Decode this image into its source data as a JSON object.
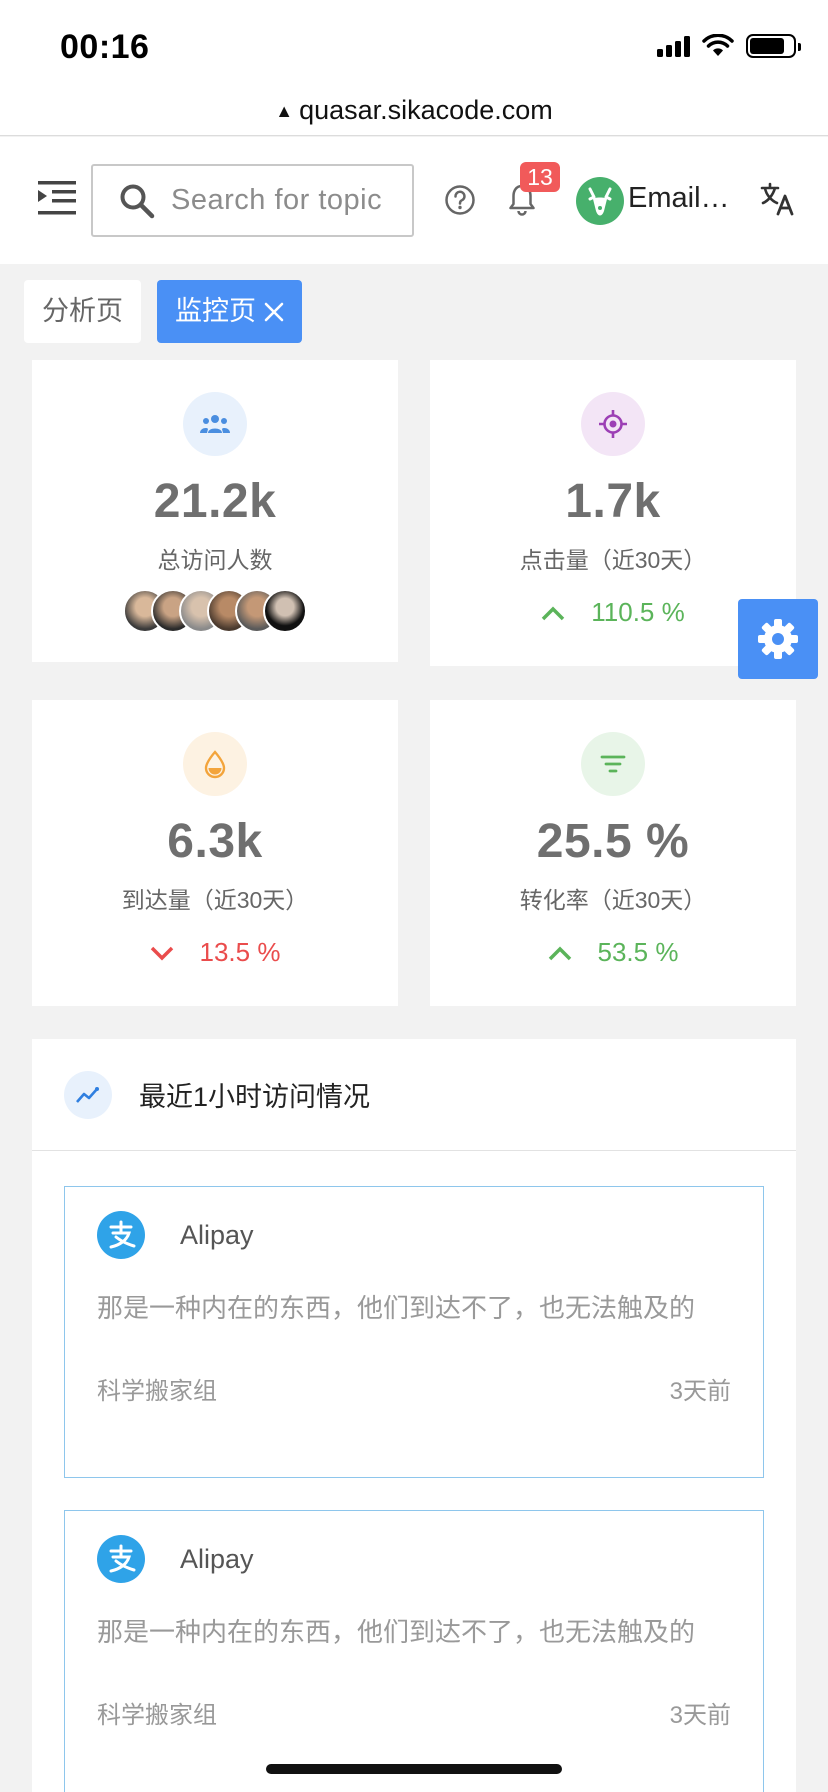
{
  "status_bar": {
    "time": "00:16"
  },
  "browser": {
    "url": "quasar.sikacode.com"
  },
  "header": {
    "search_placeholder": "Search for topic",
    "notification_count": "13",
    "user_name": "Email…"
  },
  "tabs": [
    {
      "label": "分析页"
    },
    {
      "label": "监控页"
    }
  ],
  "stats": [
    {
      "value": "21.2k",
      "label": "总访问人数",
      "icon": "people-icon",
      "icon_color": "#4a8ee0",
      "icon_bg": "#e8f1fc"
    },
    {
      "value": "1.7k",
      "label": "点击量（近30天）",
      "trend": "110.5 %",
      "trend_dir": "up",
      "icon": "target-icon",
      "icon_color": "#9c3fb5",
      "icon_bg": "#f3e5f6"
    },
    {
      "value": "6.3k",
      "label": "到达量（近30天）",
      "trend": "13.5 %",
      "trend_dir": "down",
      "icon": "drop-icon",
      "icon_color": "#f3a43b",
      "icon_bg": "#fdf2e2"
    },
    {
      "value": "25.5 %",
      "label": "转化率（近30天）",
      "trend": "53.5 %",
      "trend_dir": "up",
      "icon": "filter-icon",
      "icon_color": "#5bb45a",
      "icon_bg": "#e8f5e8"
    }
  ],
  "colors": {
    "primary": "#4a90f5",
    "up": "#5bb45a",
    "down": "#ea4c4c",
    "alipay": "#2fa3e8"
  },
  "activity": {
    "title": "最近1小时访问情况",
    "items": [
      {
        "title": "Alipay",
        "description": "那是一种内在的东西，他们到达不了，也无法触及的",
        "group": "科学搬家组",
        "time": "3天前"
      },
      {
        "title": "Alipay",
        "description": "那是一种内在的东西，他们到达不了，也无法触及的",
        "group": "科学搬家组",
        "time": "3天前"
      }
    ]
  }
}
